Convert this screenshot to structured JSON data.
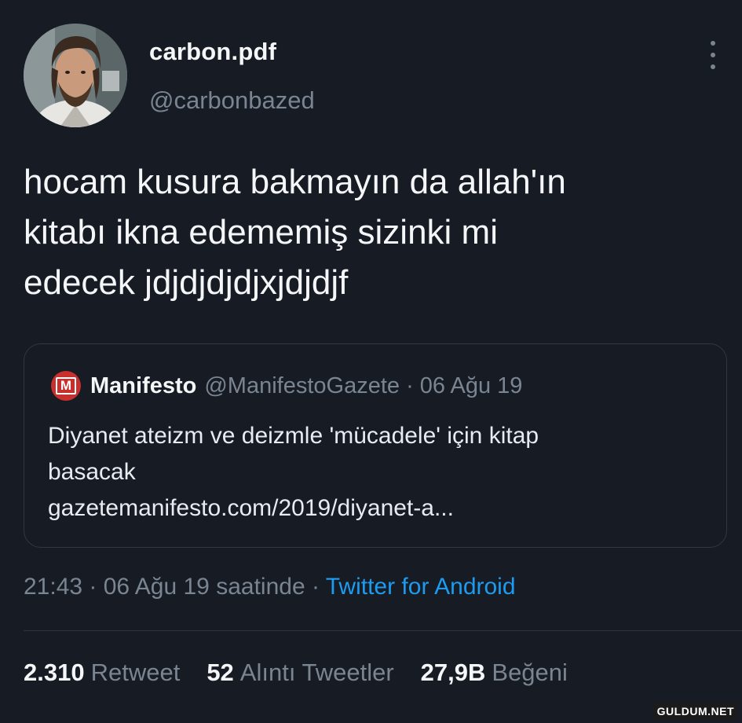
{
  "author": {
    "display_name": "carbon.pdf",
    "handle": "@carbonbazed",
    "avatar_icon": "profile-photo"
  },
  "menu": {
    "more_icon": "three-dot-vertical-icon"
  },
  "tweet": {
    "lines": [
      "hocam kusura bakmayın da allah'ın",
      "kitabı ikna edememiş sizinki mi",
      "edecek jdjdjdjdjxjdjdjf"
    ]
  },
  "quote": {
    "logo_letter": "M",
    "logo_color": "#c8302d",
    "name": "Manifesto",
    "meta": "@ManifestoGazete · 06 Ağu 19",
    "lines": [
      "Diyanet ateizm ve deizmle 'mücadele' için kitap",
      "basacak",
      "gazetemanifesto.com/2019/diyanet-a..."
    ]
  },
  "timestamp": {
    "text": "21:43 · 06 Ağu 19 saatinde · ",
    "source": "Twitter for Android",
    "source_color": "#1d9bf0"
  },
  "stats": {
    "retweets_value": "2.310",
    "retweets_label": "Retweet",
    "quotes_value": "52",
    "quotes_label": "Alıntı Tweetler",
    "likes_value": "27,9B",
    "likes_label": "Beğeni"
  },
  "watermark": "GULDUM.NET",
  "colors": {
    "background": "#161b24",
    "text_primary": "#f4f6f8",
    "text_secondary": "#7a8591",
    "border": "#2f3844"
  }
}
